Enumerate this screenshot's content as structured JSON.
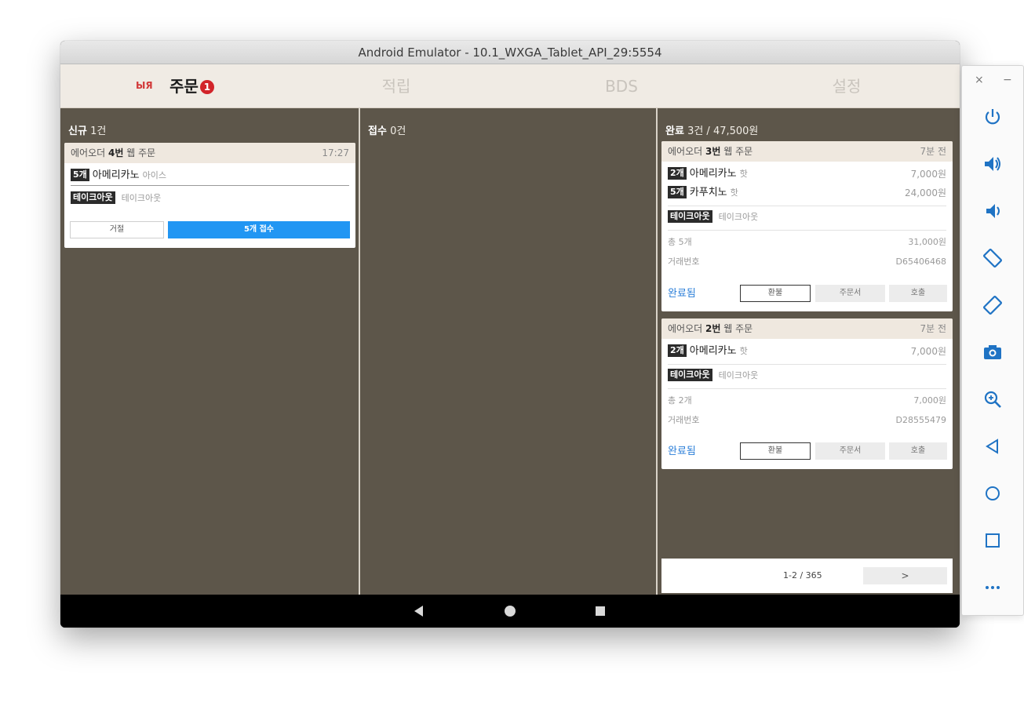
{
  "window": {
    "title": "Android Emulator - 10.1_WXGA_Tablet_API_29:5554"
  },
  "nav": {
    "logo": "ЫЯ",
    "tabs": [
      {
        "label": "주문",
        "badge": "1",
        "active": true
      },
      {
        "label": "적립",
        "active": false
      },
      {
        "label": "BDS",
        "active": false
      },
      {
        "label": "설정",
        "active": false
      }
    ]
  },
  "columns": {
    "new": {
      "title": "신규",
      "count": "1건",
      "orders": [
        {
          "header_prefix": "에어오더",
          "number": "4번",
          "header_suffix": "웹 주문",
          "time": "17:27",
          "items": [
            {
              "qty": "5개",
              "name": "아메리카노",
              "option": "아이스"
            }
          ],
          "takeout": {
            "tag": "테이크아웃",
            "text": "테이크아웃"
          },
          "buttons": {
            "reject": "거절",
            "accept": "5개 접수"
          }
        }
      ]
    },
    "accepted": {
      "title": "접수",
      "count": "0건"
    },
    "done": {
      "title": "완료",
      "summary": "3건 / 47,500원",
      "orders": [
        {
          "header_prefix": "에어오더",
          "number": "3번",
          "header_suffix": "웹 주문",
          "time": "7분 전",
          "items": [
            {
              "qty": "2개",
              "name": "아메리카노",
              "option": "핫",
              "price": "7,000원"
            },
            {
              "qty": "5개",
              "name": "카푸치노",
              "option": "핫",
              "price": "24,000원"
            }
          ],
          "takeout": {
            "tag": "테이크아웃",
            "text": "테이크아웃"
          },
          "total_label": "총 5개",
          "total_value": "31,000원",
          "txn_label": "거래번호",
          "txn_value": "D65406468",
          "status": "완료됨",
          "buttons": {
            "refund": "환불",
            "receipt": "주문서",
            "call": "호출"
          }
        },
        {
          "header_prefix": "에어오더",
          "number": "2번",
          "header_suffix": "웹 주문",
          "time": "7분 전",
          "items": [
            {
              "qty": "2개",
              "name": "아메리카노",
              "option": "핫",
              "price": "7,000원"
            }
          ],
          "takeout": {
            "tag": "테이크아웃",
            "text": "테이크아웃"
          },
          "total_label": "총 2개",
          "total_value": "7,000원",
          "txn_label": "거래번호",
          "txn_value": "D28555479",
          "status": "완료됨",
          "buttons": {
            "refund": "환불",
            "receipt": "주문서",
            "call": "호출"
          }
        }
      ],
      "pagination": {
        "range": "1-2 / 365",
        "next": ">"
      }
    }
  },
  "toolbar": {
    "close": "×",
    "minimize": "−",
    "icons": [
      "power-icon",
      "volume-up-icon",
      "volume-down-icon",
      "rotate-left-icon",
      "rotate-right-icon",
      "camera-icon",
      "zoom-icon",
      "back-icon",
      "home-icon",
      "overview-icon",
      "more-icon"
    ]
  },
  "colors": {
    "content_bg": "#5d564a",
    "nav_bg": "#f0ebe4",
    "accent": "#2196f3",
    "badge": "#d2242a",
    "link": "#2a7ed8"
  }
}
